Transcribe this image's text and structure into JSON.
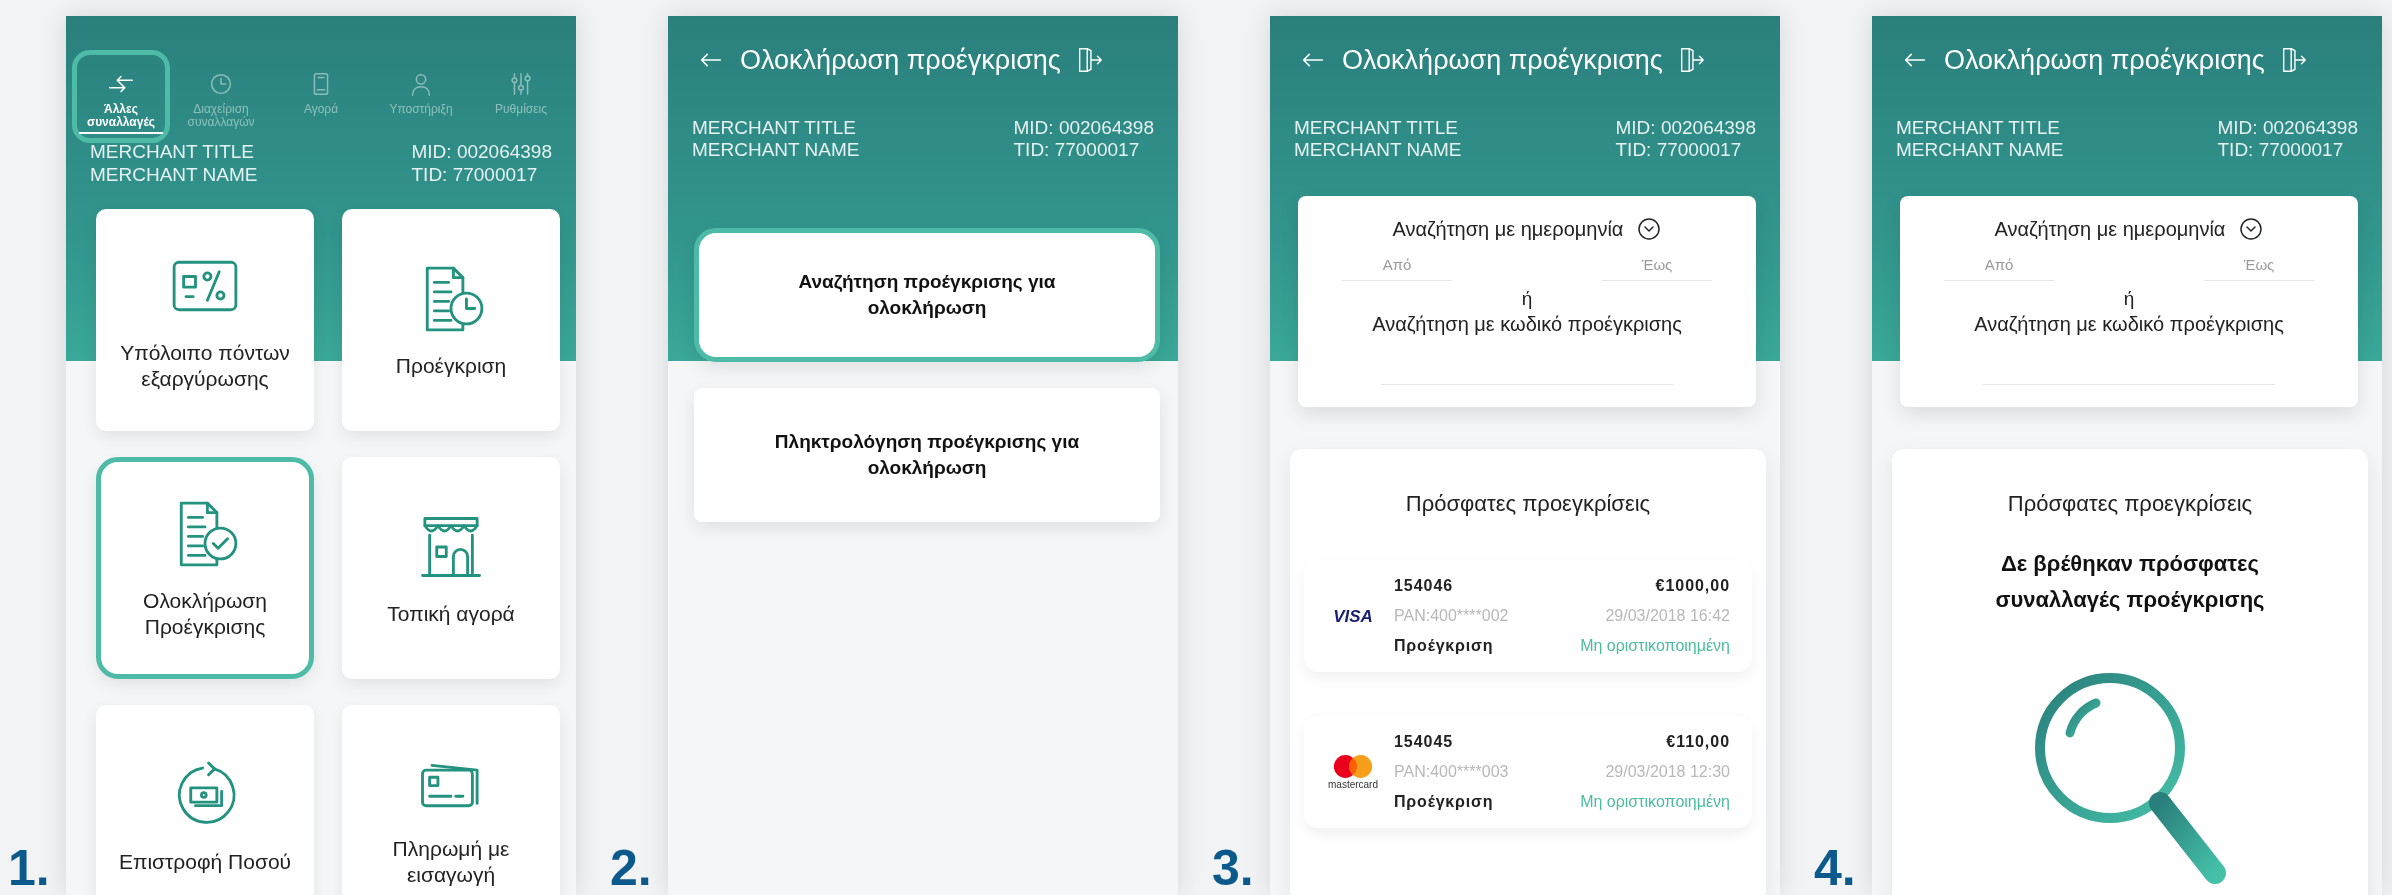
{
  "screens": [
    {
      "kind": "menu",
      "step": "1.",
      "tabs": [
        {
          "label": "Άλλες συναλλαγές",
          "selected": true,
          "highlighted": true
        },
        {
          "label": "Διαχείριση συναλλαγών",
          "selected": false,
          "highlighted": false
        },
        {
          "label": "Αγορά",
          "selected": false,
          "highlighted": false
        },
        {
          "label": "Υποστήριξη",
          "selected": false,
          "highlighted": false
        },
        {
          "label": "Ρυθμίσεις",
          "selected": false,
          "highlighted": false
        }
      ],
      "merchant": {
        "title": "MERCHANT TITLE",
        "name": "MERCHANT NAME",
        "mid": "MID: 002064398",
        "tid": "TID: 77000017"
      },
      "tiles": [
        {
          "label": "Υπόλοιπο πόντων εξαργύρωσης",
          "highlighted": false
        },
        {
          "label": "Προέγκριση",
          "highlighted": false
        },
        {
          "label": "Ολοκλήρωση Προέγκρισης",
          "highlighted": true
        },
        {
          "label": "Τοπική αγορά",
          "highlighted": false
        },
        {
          "label": "Επιστροφή Ποσού",
          "highlighted": false
        },
        {
          "label": "Πληρωμή με εισαγωγή",
          "highlighted": false
        }
      ]
    },
    {
      "kind": "options",
      "step": "2.",
      "title": "Ολοκλήρωση προέγκρισης",
      "merchant": {
        "title": "MERCHANT TITLE",
        "name": "MERCHANT NAME",
        "mid": "MID: 002064398",
        "tid": "TID: 77000017"
      },
      "options": [
        {
          "label": "Αναζήτηση προέγκρισης για ολοκλήρωση",
          "highlighted": true
        },
        {
          "label": "Πληκτρολόγηση προέγκρισης για ολοκλήρωση",
          "highlighted": false
        }
      ]
    },
    {
      "kind": "search",
      "step": "3.",
      "title": "Ολοκλήρωση προέγκρισης",
      "merchant": {
        "title": "MERCHANT TITLE",
        "name": "MERCHANT NAME",
        "mid": "MID: 002064398",
        "tid": "TID: 77000017"
      },
      "search": {
        "date_label": "Αναζήτηση με ημερομηνία",
        "from_placeholder": "Από",
        "to_placeholder": "Έως",
        "or": "ή",
        "code_label": "Αναζήτηση με κωδικό προέγκρισης"
      },
      "recent": {
        "title": "Πρόσφατες προεγκρίσεις",
        "transactions": [
          {
            "kind": "visa",
            "logo_text": "VISA",
            "code": "154046",
            "amount": "€1000,00",
            "pan": "PAN:400****002",
            "datetime": "29/03/2018 16:42",
            "type": "Προέγκριση",
            "status": "Μη οριστικοποιημένη"
          },
          {
            "kind": "mastercard",
            "logo_text": "mastercard",
            "code": "154045",
            "amount": "€110,00",
            "pan": "PAN:400****003",
            "datetime": "29/03/2018 12:30",
            "type": "Προέγκριση",
            "status": "Μη οριστικοποιημένη"
          }
        ]
      }
    },
    {
      "kind": "search",
      "step": "4.",
      "title": "Ολοκλήρωση προέγκρισης",
      "merchant": {
        "title": "MERCHANT TITLE",
        "name": "MERCHANT NAME",
        "mid": "MID: 002064398",
        "tid": "TID: 77000017"
      },
      "search": {
        "date_label": "Αναζήτηση με ημερομηνία",
        "from_placeholder": "Από",
        "to_placeholder": "Έως",
        "or": "ή",
        "code_label": "Αναζήτηση με κωδικό προέγκρισης"
      },
      "recent": {
        "title": "Πρόσφατες προεγκρίσεις",
        "empty_message": "Δε βρέθηκαν πρόσφατες συναλλαγές προέγκρισης"
      }
    }
  ]
}
